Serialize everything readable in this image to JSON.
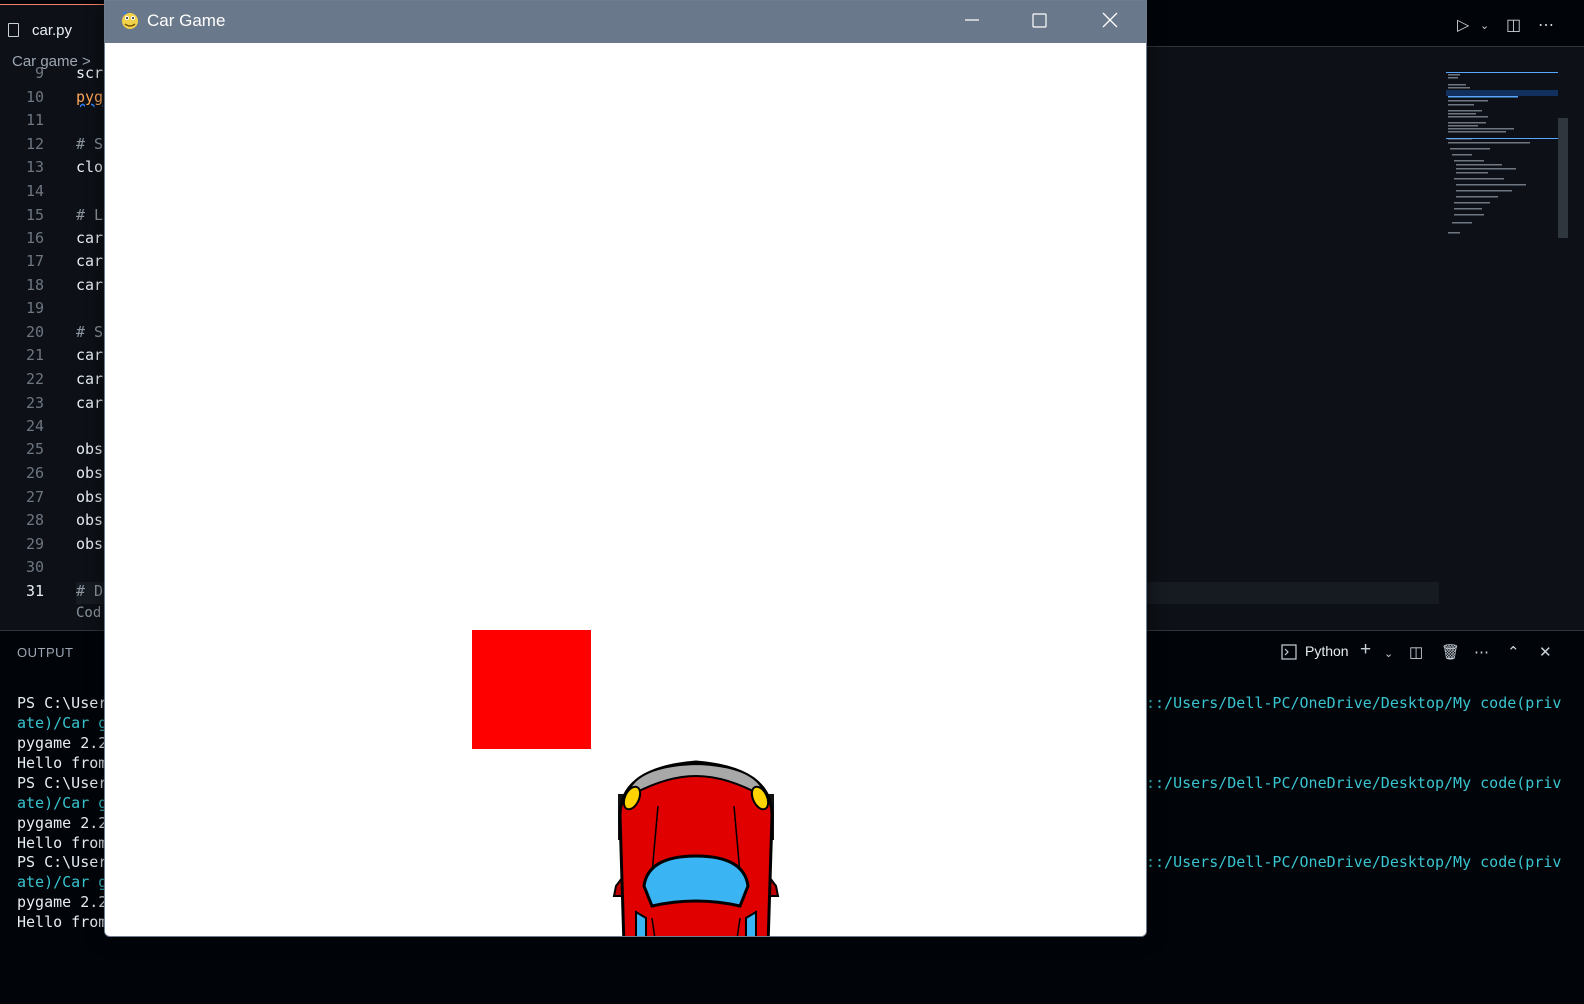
{
  "editor": {
    "tab_label": "car.py",
    "breadcrumb": "Car game  >",
    "line_numbers": [
      "9",
      "10",
      "11",
      "12",
      "13",
      "14",
      "15",
      "16",
      "17",
      "18",
      "19",
      "20",
      "21",
      "22",
      "23",
      "24",
      "25",
      "26",
      "27",
      "28",
      "29",
      "30",
      "31"
    ],
    "code_lines": {
      "l9": "scr",
      "l10": "pyg",
      "l12": "# S",
      "l13": "clo",
      "l15": "# L",
      "l16": "car",
      "l17": "car",
      "l18": "car",
      "l20": "# S",
      "l21": "car",
      "l22": "car",
      "l23": "car",
      "l25": "obs",
      "l26": "obs",
      "l27": "obs",
      "l28": "obs",
      "l29": "obs",
      "l31": "# D",
      "codelens": "Cod"
    }
  },
  "panel": {
    "output_tab": "OUTPUT",
    "terminal_profile": "Python",
    "lines": [
      {
        "text": "PS C:\\User",
        "cls": ""
      },
      {
        "text": "ate)/Car g",
        "cls": "cy"
      },
      {
        "text": "pygame 2.2",
        "cls": ""
      },
      {
        "text": "Hello from",
        "cls": ""
      },
      {
        "text": "PS C:\\User",
        "cls": ""
      },
      {
        "text": "ate)/Car g",
        "cls": "cy"
      },
      {
        "text": "pygame 2.2",
        "cls": ""
      },
      {
        "text": "Hello from",
        "cls": ""
      },
      {
        "text": "PS C:\\User",
        "cls": ""
      },
      {
        "text": "ate)/Car g",
        "cls": "cy"
      },
      {
        "text": "pygame 2.2",
        "cls": ""
      },
      {
        "text": "Hello from",
        "cls": ""
      }
    ],
    "right_path_1": "::/Users/Dell-PC/OneDrive/Desktop/My code(priv",
    "right_path_2": "::/Users/Dell-PC/OneDrive/Desktop/My code(priv",
    "right_path_3": "::/Users/Dell-PC/OneDrive/Desktop/My code(priv"
  },
  "game_window": {
    "title": "Car Game",
    "obstacle_color": "#ff0000",
    "car_color": "#e00000"
  }
}
